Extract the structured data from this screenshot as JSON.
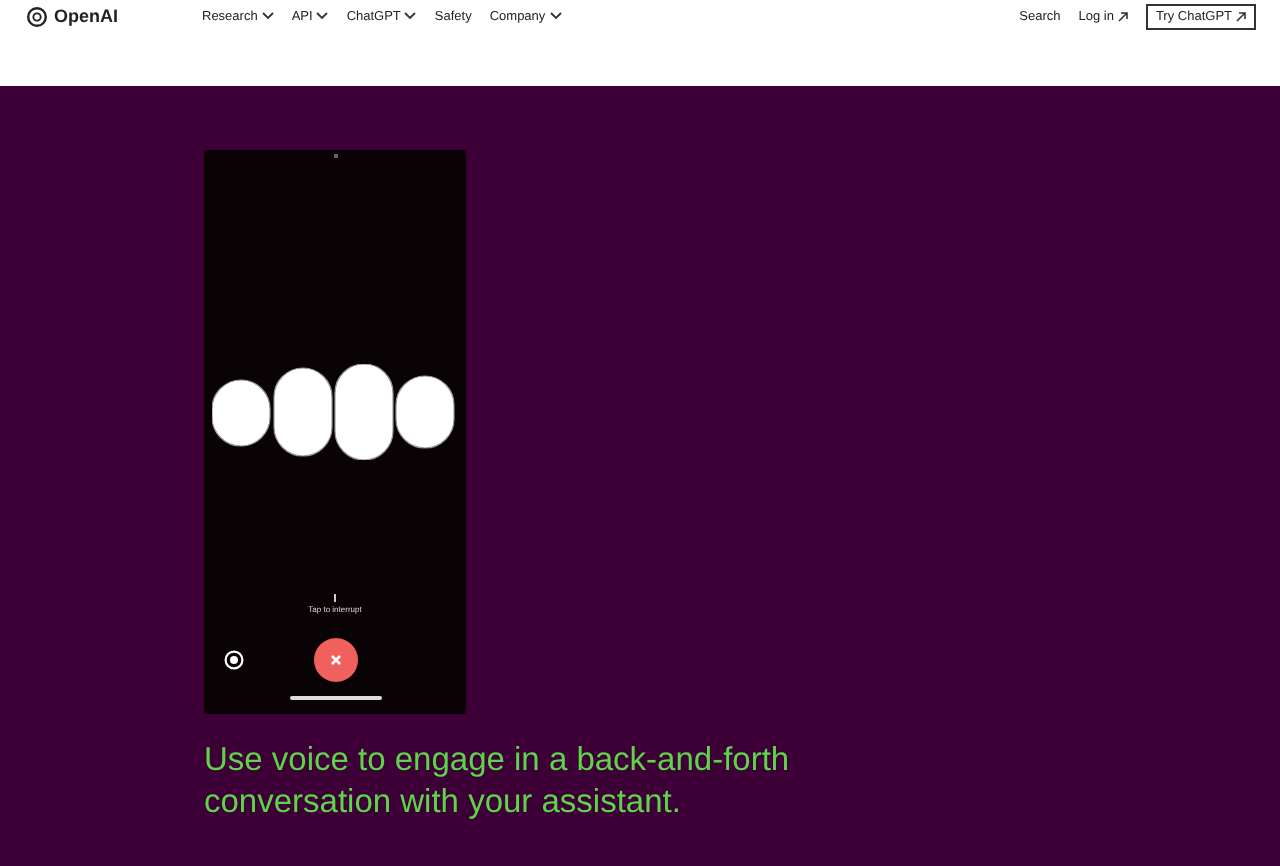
{
  "header": {
    "logo": "OpenAI",
    "nav": [
      {
        "label": "Research",
        "dropdown": true
      },
      {
        "label": "API",
        "dropdown": true
      },
      {
        "label": "ChatGPT",
        "dropdown": true
      },
      {
        "label": "Safety",
        "dropdown": false
      },
      {
        "label": "Company",
        "dropdown": true
      }
    ],
    "search": "Search",
    "login": "Log in",
    "cta": "Try ChatGPT"
  },
  "phone": {
    "status": "Tap to interrupt"
  },
  "caption": "Use voice to engage in a back-and-forth conversation with your assistant."
}
